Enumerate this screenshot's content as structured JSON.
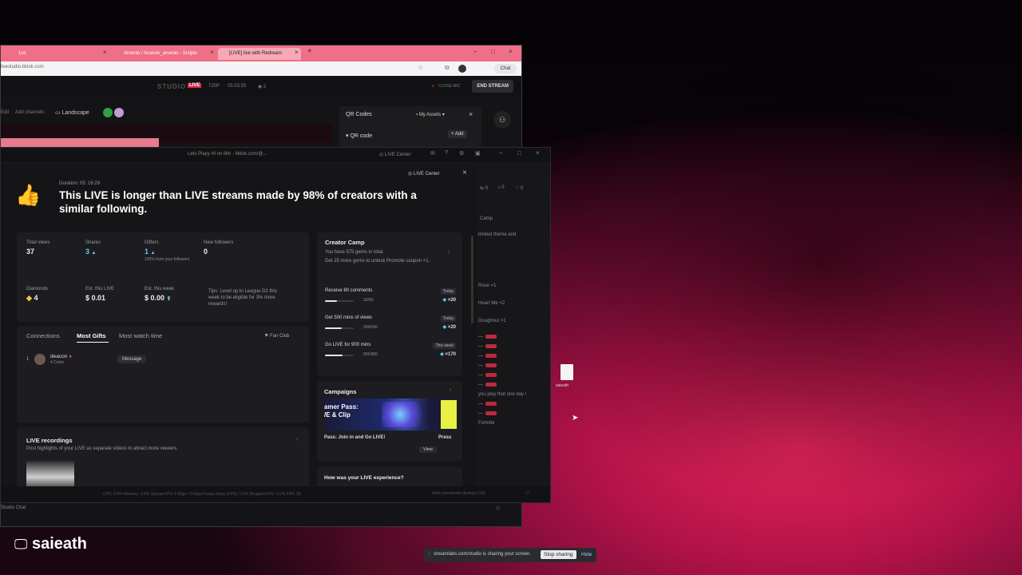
{
  "browser": {
    "tabs": [
      {
        "label": "1oc"
      },
      {
        "label": "Arsenio / Arsenio_arsenio - Scripts"
      },
      {
        "label": "[LIVE] live with Redream"
      }
    ],
    "address": "livestudio.tiktok.com",
    "chat_label": "Chat"
  },
  "studio": {
    "logo": "STUDIO",
    "logo_badge": "LIVE",
    "quality": "720P",
    "timer": "05:53:55",
    "viewers": "2",
    "close_mic": "CLOSE MIC",
    "end_stream": "END STREAM",
    "toolbar_edit": "Edit",
    "add_channels": "Add channels",
    "landscape": "Landscape",
    "panel_title": "QR Codes",
    "my_assets": "My Assets",
    "qr_code": "QR code",
    "add": "+ Add"
  },
  "live_center": {
    "window_title": "Lets Playy Hi on life! - tiktok.com/@...",
    "toolbar_label": "LIVE Center",
    "header_badge": "LIVE Center",
    "duration": "Duration: 05: 16:29",
    "headline": "This LIVE is longer than LIVE streams made by 98% of creators with a similar following.",
    "stats": [
      {
        "label": "Total views",
        "value": "37",
        "sub": ""
      },
      {
        "label": "Shares",
        "value": "3",
        "sub": ""
      },
      {
        "label": "Gifters",
        "value": "1",
        "sub": "100% from your followers"
      },
      {
        "label": "New followers",
        "value": "0",
        "sub": ""
      }
    ],
    "earnings": [
      {
        "label": "Diamonds",
        "value": "4"
      },
      {
        "label": "Est. this LIVE",
        "value": "$ 0.01"
      },
      {
        "label": "Est. this week",
        "value": "$ 0.00"
      }
    ],
    "tip": "Tips: Level up to League D2 this week to be eligible for 3% more rewards!",
    "tabs": [
      "Connections",
      "Most Gifts",
      "Most watch time"
    ],
    "fan_club": "Fan Club",
    "gifter": {
      "rank": "1",
      "name": "deacon",
      "coins": "4 Coins",
      "action": "Message"
    },
    "recordings_title": "LIVE recordings",
    "recordings_desc": "Post highlights of your LIVE as separate videos to attract more viewers.",
    "camp": {
      "title": "Creator Camp",
      "gems": "You have 575 gems in total.",
      "unlock": "Get 25 more gems to unlock Promote coupon ×1.",
      "tasks": [
        {
          "name": "Receive 80 comments",
          "period": "Today",
          "progress": "33/80",
          "fraction": 0.41,
          "reward": "×20"
        },
        {
          "name": "Get 500 mins of views",
          "period": "Today",
          "progress": "284/500",
          "fraction": 0.57,
          "reward": "×20"
        },
        {
          "name": "Go LIVE for 900 mins",
          "period": "This week",
          "progress": "555/900",
          "fraction": 0.62,
          "reward": "×170"
        }
      ]
    },
    "campaigns": {
      "title": "Campaigns",
      "banner_line1": "amer Pass:",
      "banner_line2": "/E & Clip",
      "banner_caption": "Pass: Join in and Go LIVE!",
      "banner_right": "Press",
      "view": "View"
    },
    "experience": "How was your LIVE experience?",
    "side": {
      "counters": [
        "0",
        "0",
        "0"
      ],
      "camp_short": "Camp",
      "limited": "limited theme and",
      "gifts": [
        "Rose ×1",
        "Heart Me ×2",
        "Doughnut ×1"
      ],
      "comments": [
        "you play that one day i",
        "Fortnite"
      ]
    },
    "bottom_status": "CPU: 0.0%   Memory: 0.0%   Upload FPS: 0 Kbps / 0 kbps   Frame drops (FPS): 0.0%   Dropped FPS: 0.0%   FPS: 30",
    "comment_placeholder": "Add comments during LIVE"
  },
  "desktop": {
    "file_label": "saieath",
    "presenter": "saieath",
    "sharing_text": "streamlabs.com/studio is sharing your screen.",
    "stop_sharing": "Stop sharing",
    "hide": "Hide"
  },
  "colors": {
    "accent_pink": "#ef6f86",
    "live_red": "#e0244a",
    "panel_bg": "#17171a"
  }
}
